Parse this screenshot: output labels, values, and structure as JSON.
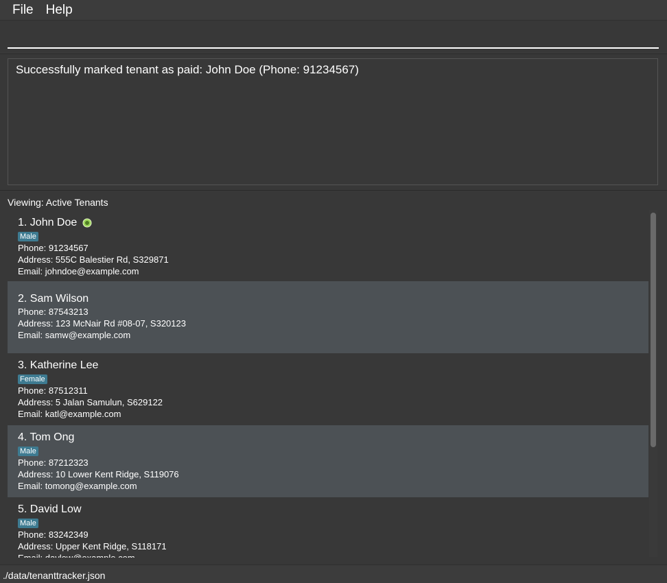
{
  "menu": {
    "file_label": "File",
    "help_label": "Help"
  },
  "command": {
    "value": "",
    "placeholder": ""
  },
  "result": {
    "message": "Successfully marked tenant as paid: John Doe (Phone: 91234567)"
  },
  "list": {
    "title": "Viewing: Active Tenants",
    "tenants": [
      {
        "index_name": "1. John Doe",
        "paid": true,
        "tag": "Male",
        "phone": "Phone: 91234567",
        "address": "Address: 555C Balestier Rd, S329871",
        "email": "Email: johndoe@example.com"
      },
      {
        "index_name": "2. Sam Wilson",
        "paid": false,
        "tag": "",
        "phone": "Phone: 87543213",
        "address": "Address: 123 McNair Rd #08-07, S320123",
        "email": "Email: samw@example.com"
      },
      {
        "index_name": "3. Katherine Lee",
        "paid": false,
        "tag": "Female",
        "phone": "Phone: 87512311",
        "address": "Address: 5 Jalan Samulun, S629122",
        "email": "Email: katl@example.com"
      },
      {
        "index_name": "4. Tom Ong",
        "paid": false,
        "tag": "Male",
        "phone": "Phone: 87212323",
        "address": "Address: 10 Lower Kent Ridge, S119076",
        "email": "Email: tomong@example.com"
      },
      {
        "index_name": "5. David Low",
        "paid": false,
        "tag": "Male",
        "phone": "Phone: 83242349",
        "address": "Address: Upper Kent Ridge, S118171",
        "email": "Email: davlow@example.com"
      }
    ]
  },
  "status": {
    "file_path": "./data/tenanttracker.json"
  },
  "colors": {
    "tag_bg": "#3e7b91",
    "alt_row": "#4c5155",
    "paid_icon": "#9dd65a"
  }
}
